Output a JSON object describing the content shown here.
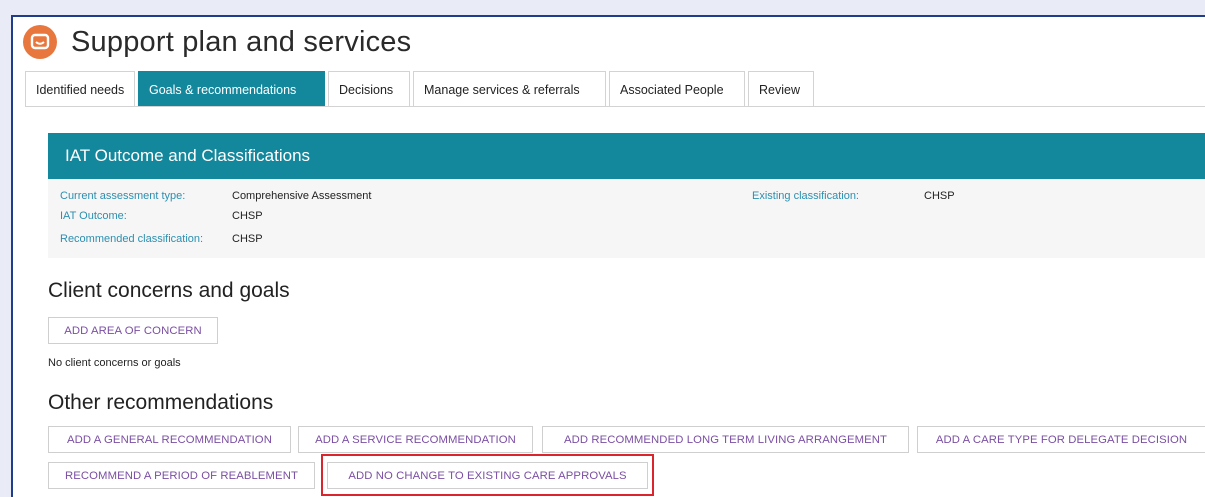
{
  "page": {
    "title": "Support plan and services",
    "logo_icon": "care-logo-icon",
    "accent_color": "#13879c",
    "logo_color": "#e8773e"
  },
  "tabs": [
    {
      "label": "Identified needs",
      "active": false
    },
    {
      "label": "Goals & recommendations",
      "active": true
    },
    {
      "label": "Decisions",
      "active": false
    },
    {
      "label": "Manage services & referrals",
      "active": false
    },
    {
      "label": "Associated People",
      "active": false
    },
    {
      "label": "Review",
      "active": false
    }
  ],
  "iat_panel": {
    "title": "IAT Outcome and Classifications",
    "current_assessment_type_label": "Current assessment type:",
    "current_assessment_type_value": "Comprehensive Assessment",
    "iat_outcome_label": "IAT Outcome:",
    "iat_outcome_value": "CHSP",
    "recommended_classification_label": "Recommended classification:",
    "recommended_classification_value": "CHSP",
    "existing_classification_label": "Existing classification:",
    "existing_classification_value": "CHSP"
  },
  "client_concerns": {
    "title": "Client concerns and goals",
    "add_button": "ADD AREA OF CONCERN",
    "empty_text": "No client concerns or goals"
  },
  "other_recommendations": {
    "title": "Other recommendations",
    "buttons": [
      "ADD A GENERAL RECOMMENDATION",
      "ADD A SERVICE RECOMMENDATION",
      "ADD RECOMMENDED LONG TERM LIVING ARRANGEMENT",
      "ADD A CARE TYPE FOR DELEGATE DECISION",
      "RECOMMEND A PERIOD OF REABLEMENT",
      "ADD NO CHANGE TO EXISTING CARE APPROVALS"
    ],
    "highlight_color": "#d9252b"
  }
}
